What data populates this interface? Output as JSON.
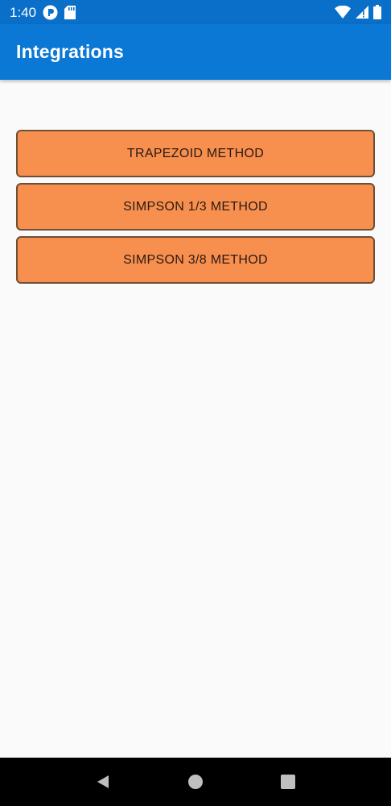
{
  "status_bar": {
    "time": "1:40",
    "icons": [
      "notification-p-icon",
      "sd-card-icon",
      "wifi-icon",
      "signal-icon",
      "battery-icon"
    ]
  },
  "app_bar": {
    "title": "Integrations"
  },
  "buttons": [
    {
      "label": "TRAPEZOID METHOD"
    },
    {
      "label": "SIMPSON 1/3 METHOD"
    },
    {
      "label": "SIMPSON 3/8 METHOD"
    }
  ],
  "nav_bar": {
    "icons": [
      "back-icon",
      "home-icon",
      "recents-icon"
    ]
  },
  "colors": {
    "status_bar": "#0a6fc9",
    "app_bar": "#0a78d4",
    "button_fill": "#f78f4f",
    "button_border": "#6e4f35",
    "background": "#fafafa"
  }
}
